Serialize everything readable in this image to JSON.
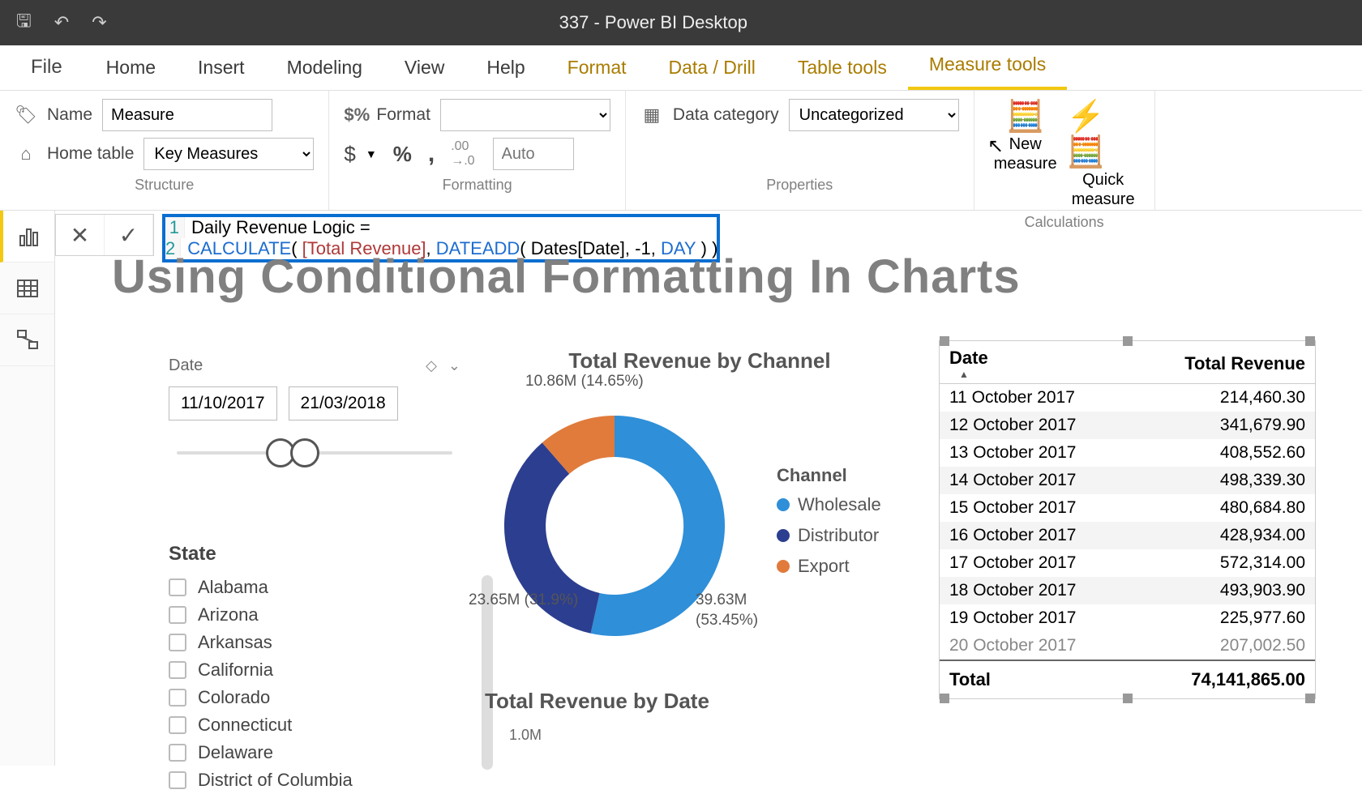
{
  "titlebar": {
    "title": "337 - Power BI Desktop"
  },
  "tabs": {
    "file": "File",
    "list": [
      "Home",
      "Insert",
      "Modeling",
      "View",
      "Help"
    ],
    "context": [
      "Format",
      "Data / Drill",
      "Table tools",
      "Measure tools"
    ],
    "active": "Measure tools"
  },
  "ribbon": {
    "structure": {
      "name_label": "Name",
      "name_value": "Measure",
      "home_table_label": "Home table",
      "home_table_value": "Key Measures",
      "group": "Structure"
    },
    "formatting": {
      "format_label": "Format",
      "format_value": "",
      "currency": "$",
      "percent": "%",
      "comma": ",",
      "decimals": ".00→.0",
      "auto": "Auto",
      "group": "Formatting"
    },
    "properties": {
      "category_label": "Data category",
      "category_value": "Uncategorized",
      "group": "Properties"
    },
    "calculations": {
      "new_measure": "New measure",
      "quick_measure": "Quick measure",
      "group": "Calculations"
    }
  },
  "formula": {
    "line1": "Daily Revenue Logic =",
    "fn_calculate": "CALCULATE",
    "measure_ref": "[Total Revenue]",
    "fn_dateadd": "DATEADD",
    "col_ref": "Dates[Date]",
    "num": "-1",
    "const_day": "DAY"
  },
  "page": {
    "title": "Using Conditional Formatting In Charts"
  },
  "slicer_date": {
    "label": "Date",
    "start": "11/10/2017",
    "end": "21/03/2018"
  },
  "slicer_state": {
    "label": "State",
    "items": [
      "Alabama",
      "Arizona",
      "Arkansas",
      "California",
      "Colorado",
      "Connecticut",
      "Delaware",
      "District of Columbia"
    ]
  },
  "chart_data": [
    {
      "type": "pie",
      "title": "Total Revenue by Channel",
      "legend_title": "Channel",
      "series": [
        {
          "name": "Wholesale",
          "value": 39.63,
          "pct": 53.45,
          "color": "#2f8fd8",
          "label": "39.63M\n(53.45%)"
        },
        {
          "name": "Distributor",
          "value": 23.65,
          "pct": 31.9,
          "color": "#2c3e8f",
          "label": "23.65M\n(31.9%)"
        },
        {
          "name": "Export",
          "value": 10.86,
          "pct": 14.65,
          "color": "#e07b3c",
          "label": "10.86M\n(14.65%)"
        }
      ]
    },
    {
      "type": "table",
      "columns": [
        "Date",
        "Total Revenue"
      ],
      "rows": [
        [
          "11 October 2017",
          "214,460.30"
        ],
        [
          "12 October 2017",
          "341,679.90"
        ],
        [
          "13 October 2017",
          "408,552.60"
        ],
        [
          "14 October 2017",
          "498,339.30"
        ],
        [
          "15 October 2017",
          "480,684.80"
        ],
        [
          "16 October 2017",
          "428,934.00"
        ],
        [
          "17 October 2017",
          "572,314.00"
        ],
        [
          "18 October 2017",
          "493,903.90"
        ],
        [
          "19 October 2017",
          "225,977.60"
        ]
      ],
      "total_label": "Total",
      "total_value": "74,141,865.00"
    },
    {
      "type": "bar",
      "title": "Total Revenue by Date",
      "ylabel_tick": "1.0M",
      "ylim": [
        0,
        1000000
      ]
    }
  ]
}
